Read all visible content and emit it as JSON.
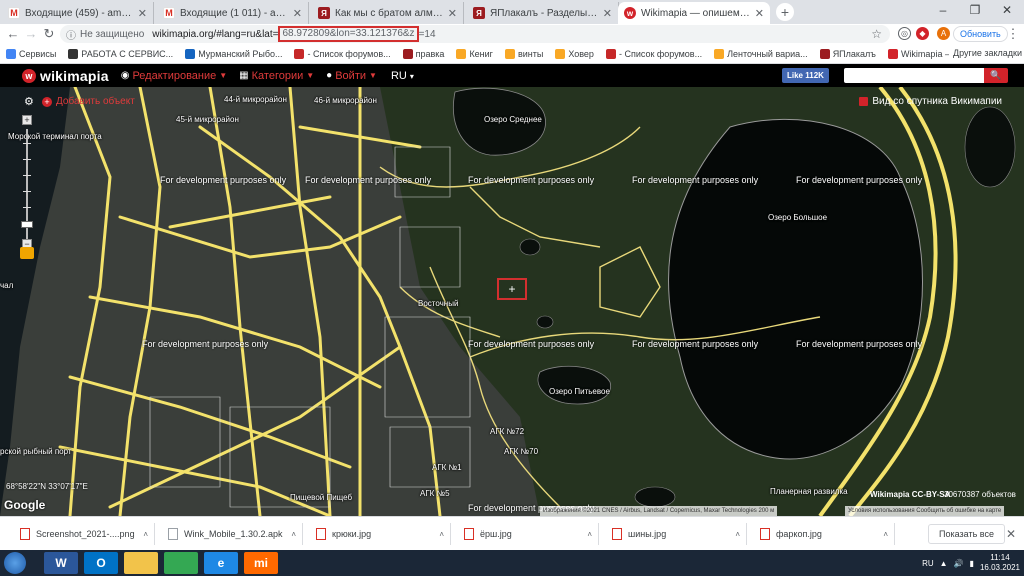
{
  "browser": {
    "tabs": [
      {
        "title": "Входящие (459) - amaizerov@gm",
        "icon": "gmail-icon",
        "active": false
      },
      {
        "title": "Входящие (1 011) - amaizerov@",
        "icon": "gmail-icon",
        "active": false
      },
      {
        "title": "Как мы с братом алмаз делали",
        "icon": "yaplakal-icon",
        "active": false
      },
      {
        "title": "ЯПлакалъ - Разделы -> Цитиру",
        "icon": "yaplakal-icon",
        "active": false
      },
      {
        "title": "Wikimapia — опишем весь мир!",
        "icon": "wikimapia-icon",
        "active": true
      }
    ],
    "new_tab": "+",
    "window_controls": {
      "minimize": "–",
      "maximize": "❐",
      "close": "✕"
    },
    "toolbar": {
      "back": "←",
      "forward": "→",
      "reload": "↻",
      "security_label": "Не защищено",
      "url_prefix": "wikimapia.org/#lang=ru&lat=",
      "url_highlight": "68.972809&lon=33.121376&z",
      "url_suffix": "=14",
      "update_button": "Обновить",
      "profile_letter": "A"
    },
    "bookmarks": [
      {
        "label": "Сервисы",
        "icon": "apps-icon",
        "color": "#4285f4"
      },
      {
        "label": "РАБОТА С СЕРВИС...",
        "icon": "site-icon",
        "color": "#333333"
      },
      {
        "label": "Мурманский Рыбо...",
        "icon": "fish-icon",
        "color": "#1565c0"
      },
      {
        "label": "- Список форумов...",
        "icon": "forum-icon",
        "color": "#c62828"
      },
      {
        "label": "правка",
        "icon": "yaplakal-icon",
        "color": "#9c1c20"
      },
      {
        "label": "Кениг",
        "icon": "folder-icon",
        "color": "#f9a825"
      },
      {
        "label": "винты",
        "icon": "folder-icon",
        "color": "#f9a825"
      },
      {
        "label": "Ховер",
        "icon": "folder-icon",
        "color": "#f9a825"
      },
      {
        "label": "- Список форумов...",
        "icon": "forum-icon",
        "color": "#c62828"
      },
      {
        "label": "Ленточный вариа...",
        "icon": "folder-icon",
        "color": "#f9a825"
      },
      {
        "label": "ЯПлакалъ",
        "icon": "yaplakal-icon",
        "color": "#9c1c20"
      },
      {
        "label": "Wikimapia — опиш...",
        "icon": "wikimapia-icon",
        "color": "#d2232a"
      }
    ],
    "bookmarks_other": "Другие закладки"
  },
  "wikimapia": {
    "logo": "wikimapia",
    "menu": [
      {
        "label": "Редактирование",
        "icon": "globe-icon"
      },
      {
        "label": "Категории",
        "icon": "grid-icon"
      },
      {
        "label": "Войти",
        "icon": "user-icon"
      }
    ],
    "lang": "RU",
    "fb_like": "Like 112K",
    "search_placeholder": "",
    "add_object": "Добавить объект",
    "satellite_view": "Вид со спутника Викимапии",
    "watermark": "For development purposes only",
    "labels": [
      {
        "text": "44-й микрорайон",
        "name": "map-label-44-mkr"
      },
      {
        "text": "46-й микрорайон",
        "name": "map-label-46-mkr"
      },
      {
        "text": "45-й микрорайон",
        "name": "map-label-45-mkr"
      },
      {
        "text": "Озеро Среднее",
        "name": "map-label-ozero-srednee"
      },
      {
        "text": "Озеро Большое",
        "name": "map-label-ozero-bolshoe"
      },
      {
        "text": "Восточный",
        "name": "map-label-vostochny"
      },
      {
        "text": "Озеро Питьевое",
        "name": "map-label-ozero-pitevoe"
      },
      {
        "text": "АГК №72",
        "name": "map-label-agk72"
      },
      {
        "text": "АГК №70",
        "name": "map-label-agk70"
      },
      {
        "text": "АГК №1",
        "name": "map-label-agk1"
      },
      {
        "text": "АГК №5",
        "name": "map-label-agk5"
      },
      {
        "text": "Пищевой Пищеб",
        "name": "map-label-pishchevoy"
      },
      {
        "text": "Планерная развилка",
        "name": "map-label-planernaya"
      },
      {
        "text": "Морской терминал порта",
        "name": "map-label-terminal"
      },
      {
        "text": "рской рыбный порт",
        "name": "map-label-fish-port"
      },
      {
        "text": "чал",
        "name": "map-label-pier"
      }
    ],
    "coordinates": "68°58'22\"N 33°07'17\"E",
    "google": "Google",
    "attribution": "Изображения ©2021 CNES / Airbus, Landsat / Copernicus, Maxar Technologies  200 м",
    "license": "Wikimapia CC-BY-SA",
    "object_count": "30670387 объектов",
    "terms": "Условия использования  Сообщить об ошибке на карте"
  },
  "downloads": {
    "items": [
      {
        "name": "Screenshot_2021-....png",
        "type": "img"
      },
      {
        "name": "Wink_Mobile_1.30.2.apk",
        "type": "file"
      },
      {
        "name": "крюки.jpg",
        "type": "img"
      },
      {
        "name": "ёрш.jpg",
        "type": "img"
      },
      {
        "name": "шины.jpg",
        "type": "img"
      },
      {
        "name": "фаркоп.jpg",
        "type": "img"
      }
    ],
    "show_all": "Показать все",
    "close": "✕"
  },
  "taskbar": {
    "apps": [
      {
        "icon": "start-icon",
        "label": "",
        "color": "#2d7bd4"
      },
      {
        "icon": "word-icon",
        "label": "W",
        "color": "#2b579a"
      },
      {
        "icon": "outlook-icon",
        "label": "O",
        "color": "#0072c6"
      },
      {
        "icon": "explorer-icon",
        "label": "",
        "color": "#f2c34a"
      },
      {
        "icon": "chrome-icon",
        "label": "",
        "color": "#34a853"
      },
      {
        "icon": "ie-icon",
        "label": "e",
        "color": "#1e88e5"
      },
      {
        "icon": "xiaomi-icon",
        "label": "mi",
        "color": "#ff6900"
      }
    ],
    "lang": "RU",
    "time": "11:14",
    "date": "16.03.2021"
  },
  "colors": {
    "brand_red": "#d2232a",
    "highlight_box": "#d32f2f",
    "map_bg": "#1d2a1a",
    "road_yellow": "#f3e26b"
  }
}
